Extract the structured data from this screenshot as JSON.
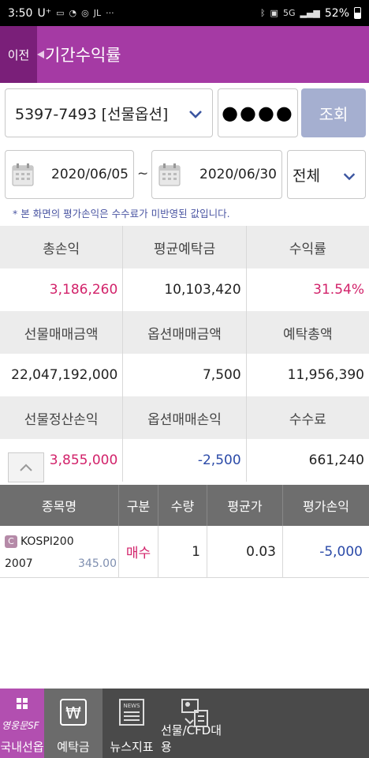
{
  "status_bar": {
    "time": "3:50",
    "carrier": "U⁺",
    "battery": "52%",
    "network": "5G"
  },
  "header": {
    "back_label": "이전",
    "title": "기간수익률"
  },
  "query": {
    "account": "5397-7493 [선물옵션]",
    "password_mask": "●●●●",
    "search_label": "조회"
  },
  "period": {
    "from": "2020/06/05",
    "separator": "~",
    "to": "2020/06/30",
    "type": "전체"
  },
  "notice": "* 본 화면의 평가손익은 수수료가 미반영된 값입니다.",
  "summary": {
    "rows": [
      {
        "labels": [
          "총손익",
          "평균예탁금",
          "수익률"
        ],
        "values": [
          "3,186,260",
          "10,103,420",
          "31.54%"
        ]
      },
      {
        "labels": [
          "선물매매금액",
          "옵션매매금액",
          "예탁총액"
        ],
        "values": [
          "22,047,192,000",
          "7,500",
          "11,956,390"
        ]
      },
      {
        "labels": [
          "선물정산손익",
          "옵션매매손익",
          "수수료"
        ],
        "values": [
          "3,855,000",
          "-2,500",
          "661,240"
        ]
      }
    ]
  },
  "holdings": {
    "headers": [
      "종목명",
      "구분",
      "수량",
      "평균가",
      "평가손익"
    ],
    "rows": [
      {
        "badge": "C",
        "name": "KOSPI200",
        "expiry": "2007",
        "strike": "345.00",
        "side": "매수",
        "qty": "1",
        "avg_price": "0.03",
        "eval_pnl": "-5,000"
      }
    ]
  },
  "bottom_nav": {
    "brand": "영웅문SF",
    "items": [
      "국내선옵",
      "예탁금",
      "뉴스지표",
      "선물/CFD대용"
    ],
    "news_icon_text": "NEWS"
  },
  "colors": {
    "header_purple": "#a53aa4",
    "back_button": "#7a1f79",
    "search_button": "#a5afd0",
    "profit_red": "#d2226a",
    "loss_blue": "#2b4aa8",
    "table_header": "#6e6e6e",
    "bottom_bar": "#4a4a4a"
  }
}
